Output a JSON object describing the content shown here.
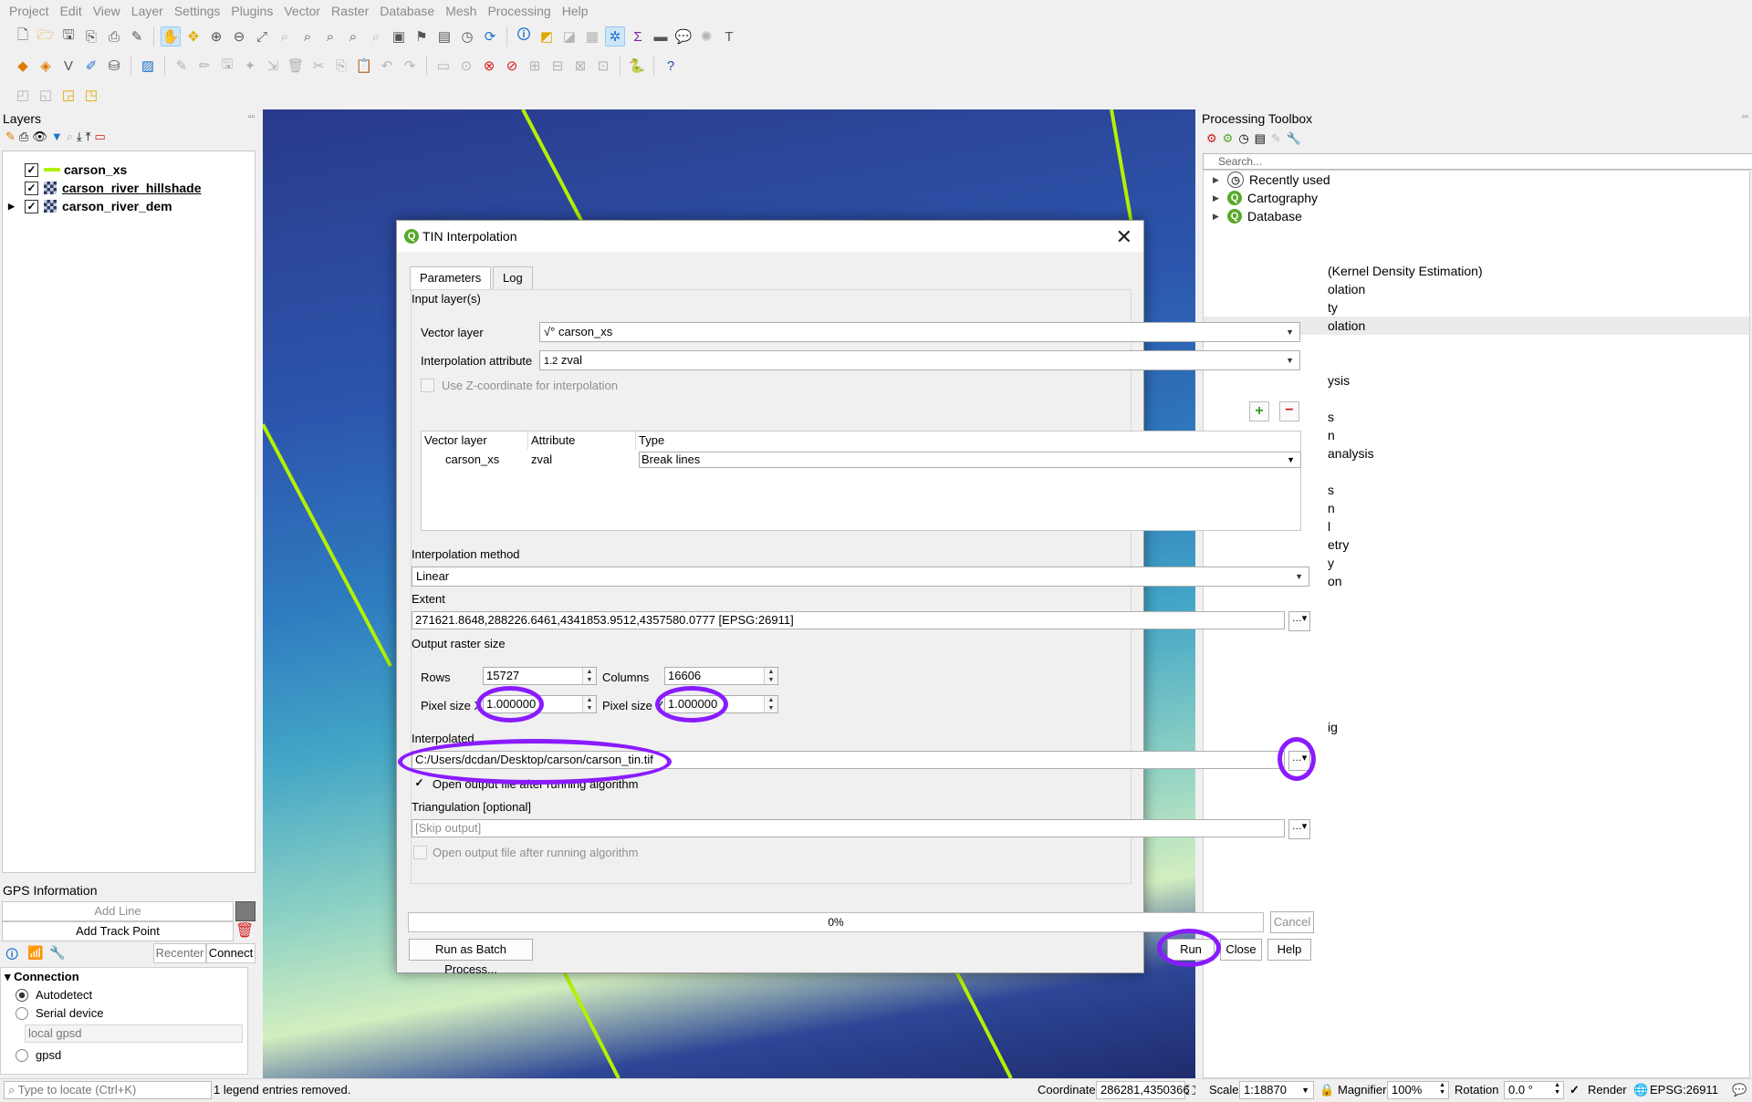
{
  "menu": [
    "Project",
    "Edit",
    "View",
    "Layer",
    "Settings",
    "Plugins",
    "Vector",
    "Raster",
    "Database",
    "Mesh",
    "Processing",
    "Help"
  ],
  "layers_panel": {
    "title": "Layers",
    "layers": [
      {
        "name": "carson_xs",
        "checked": true,
        "symbol": "line"
      },
      {
        "name": "carson_river_hillshade",
        "checked": true,
        "symbol": "raster"
      },
      {
        "name": "carson_river_dem",
        "checked": true,
        "symbol": "raster"
      }
    ]
  },
  "toolbox": {
    "title": "Processing Toolbox",
    "search_placeholder": "Search...",
    "items": [
      "Recently used",
      "Cartography",
      "Database"
    ],
    "fragments": [
      "(Kernel Density Estimation)",
      "olation",
      "ty",
      "olation",
      "ysis",
      "s",
      "n",
      "analysis",
      "s",
      "n",
      "l",
      "etry",
      "y",
      "on",
      "ig"
    ]
  },
  "gps": {
    "title": "GPS Information",
    "add_line": "Add Line",
    "add_track_point": "Add Track Point",
    "recenter": "Recenter",
    "connect": "Connect",
    "connection_label": "Connection",
    "autodetect": "Autodetect",
    "serial_device": "Serial device",
    "local_gpsd": "local gpsd",
    "gpsd": "gpsd"
  },
  "dialog": {
    "title": "TIN Interpolation",
    "tabs": [
      "Parameters",
      "Log"
    ],
    "input_layers_label": "Input layer(s)",
    "vector_layer_label": "Vector layer",
    "vector_layer_value": "carson_xs",
    "interp_attr_label": "Interpolation attribute",
    "interp_attr_prefix": "1.2",
    "interp_attr_value": "zval",
    "use_z_label": "Use Z-coordinate for interpolation",
    "table_headers": [
      "Vector layer",
      "Attribute",
      "Type"
    ],
    "table_row": {
      "layer": "carson_xs",
      "attribute": "zval",
      "type": "Break lines"
    },
    "interp_method_label": "Interpolation method",
    "interp_method_value": "Linear",
    "extent_label": "Extent",
    "extent_value": "271621.8648,288226.6461,4341853.9512,4357580.0777 [EPSG:26911]",
    "output_size_label": "Output raster size",
    "rows_label": "Rows",
    "rows_value": "15727",
    "columns_label": "Columns",
    "columns_value": "16606",
    "pixel_x_label": "Pixel size X",
    "pixel_x_value": "1.000000",
    "pixel_y_label": "Pixel size Y",
    "pixel_y_value": "1.000000",
    "interpolated_label": "Interpolated",
    "interpolated_value": "C:/Users/dcdan/Desktop/carson/carson_tin.tif",
    "open_output_label": "Open output file after running algorithm",
    "triangulation_label": "Triangulation [optional]",
    "triangulation_placeholder": "[Skip output]",
    "open_output_label2": "Open output file after running algorithm",
    "progress": "0%",
    "cancel": "Cancel",
    "batch": "Run as Batch Process...",
    "run": "Run",
    "close": "Close",
    "help": "Help"
  },
  "status": {
    "locate_placeholder": "Type to locate (Ctrl+K)",
    "message": "1 legend entries removed.",
    "coordinate_label": "Coordinate",
    "coordinate_value": "286281,4350366",
    "scale_label": "Scale",
    "scale_value": "1:18870",
    "magnifier_label": "Magnifier",
    "magnifier_value": "100%",
    "rotation_label": "Rotation",
    "rotation_value": "0.0 °",
    "render_label": "Render",
    "crs": "EPSG:26911"
  },
  "colors": {
    "annotation": "#8a1bff",
    "map_line": "#b4f000",
    "qgis_green": "#58a82a"
  }
}
